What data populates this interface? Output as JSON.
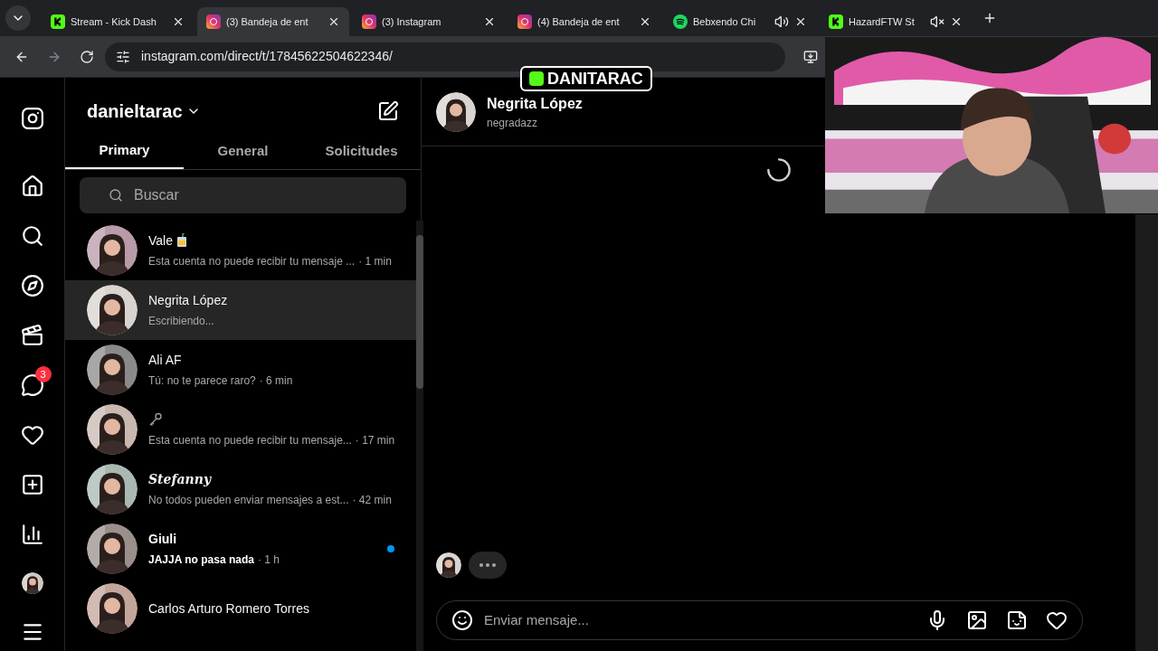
{
  "browser": {
    "tabs": [
      {
        "kind": "kick",
        "title": "Stream - Kick Dash",
        "selected": false,
        "playing": false,
        "muted": false
      },
      {
        "kind": "instagram",
        "title": "(3) Bandeja de ent",
        "selected": true,
        "playing": false,
        "muted": false
      },
      {
        "kind": "instagram",
        "title": "(3) Instagram",
        "selected": false,
        "playing": false,
        "muted": false
      },
      {
        "kind": "instagram",
        "title": "(4) Bandeja de ent",
        "selected": false,
        "playing": false,
        "muted": false
      },
      {
        "kind": "spotify",
        "title": "Bebxendo Chi",
        "selected": false,
        "playing": true,
        "muted": false
      },
      {
        "kind": "kick",
        "title": "HazardFTW St",
        "selected": false,
        "playing": false,
        "muted": true
      }
    ],
    "url": "instagram.com/direct/t/17845622504622346/"
  },
  "stream_overlay": {
    "channel_name": "DANITARAC"
  },
  "nav": {
    "items": [
      {
        "kind": "home"
      },
      {
        "kind": "search"
      },
      {
        "kind": "explore"
      },
      {
        "kind": "reels"
      },
      {
        "kind": "messages",
        "badge": "3"
      },
      {
        "kind": "notifications"
      },
      {
        "kind": "create"
      },
      {
        "kind": "dashboard"
      },
      {
        "kind": "profile"
      },
      {
        "kind": "more"
      }
    ]
  },
  "inbox": {
    "username": "danieltarac",
    "tabs": [
      {
        "label": "Primary",
        "selected": true
      },
      {
        "label": "General",
        "selected": false
      },
      {
        "label": "Solicitudes",
        "selected": false
      }
    ],
    "search": {
      "placeholder": "Buscar"
    },
    "conversations": [
      {
        "name": "Vale",
        "kind": "juice-emoji",
        "preview": "Esta cuenta no puede recibir tu mensaje ...",
        "time": "· 1 min",
        "selected": false,
        "unread": false
      },
      {
        "name": "Negrita López",
        "preview": "Escribiendo...",
        "selected": true,
        "unread": false
      },
      {
        "name": "Ali AF",
        "preview": "Tú: no te parece raro?",
        "time": "· 6 min",
        "selected": false,
        "unread": false
      },
      {
        "kind": "key-emoji",
        "preview": "Esta cuenta no puede recibir tu mensaje...",
        "time": "· 17 min",
        "selected": false,
        "unread": false
      },
      {
        "name": "Stefanny",
        "preview": "No todos pueden enviar mensajes a est...",
        "time": "· 42 min",
        "selected": false,
        "unread": false
      },
      {
        "name": "Giuli",
        "preview": "JAJJA no pasa nada",
        "time": "· 1 h",
        "selected": false,
        "unread": true
      },
      {
        "name": "Carlos Arturo Romero Torres",
        "selected": false,
        "unread": false
      }
    ]
  },
  "chat": {
    "name": "Negrita López",
    "handle": "negradazz",
    "loading": true,
    "typing": true,
    "composer": {
      "placeholder": "Enviar mensaje..."
    }
  }
}
